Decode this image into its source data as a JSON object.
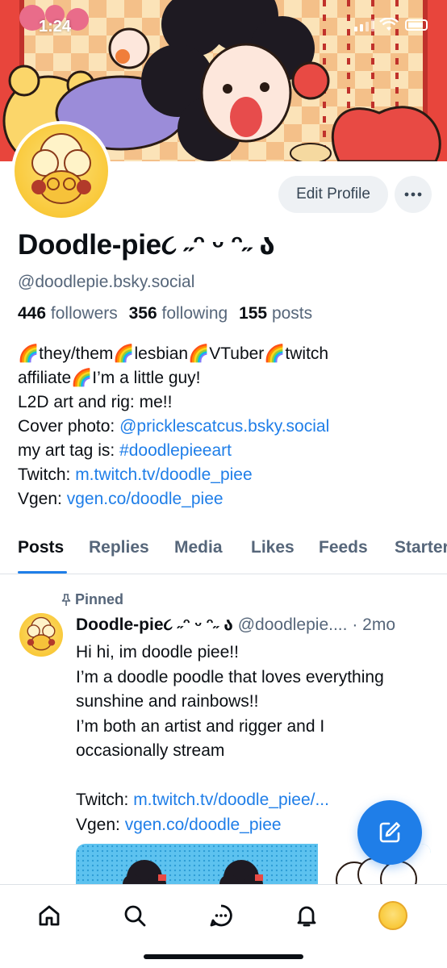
{
  "status_bar": {
    "time": "1:24"
  },
  "profile": {
    "display_name": "Doodle-pie૮ ˶ᵔ ᵕ ᵔ˶ ა",
    "handle": "@doodlepie.bsky.social",
    "stats": {
      "followers_count": "446",
      "followers_label": "followers",
      "following_count": "356",
      "following_label": "following",
      "posts_count": "155",
      "posts_label": "posts"
    },
    "edit_label": "Edit Profile",
    "bio": {
      "line1": "🌈they/them🌈lesbian🌈VTuber🌈twitch",
      "line2": "affiliate🌈I’m a little guy!",
      "line3": "L2D art and rig: me!!",
      "line4_prefix": "Cover photo: ",
      "line4_link": "@pricklescatcus.bsky.social",
      "line5_prefix": "my art tag is: ",
      "line5_link": "#doodlepieeart",
      "line6_prefix": "Twitch: ",
      "line6_link": "m.twitch.tv/doodle_piee",
      "line7_prefix": "Vgen: ",
      "line7_link": "vgen.co/doodle_piee"
    }
  },
  "tabs": [
    "Posts",
    "Replies",
    "Media",
    "Likes",
    "Feeds",
    "Starter Packs"
  ],
  "active_tab": "Posts",
  "post": {
    "pinned_label": "Pinned",
    "author_name": "Doodle-pie૮ ˶ᵔ ᵕ ᵔ˶ ა",
    "author_handle": "@doodlepie....",
    "time": "2mo",
    "lines": [
      "Hi hi, im doodle piee!!",
      "I’m a doodle poodle that loves everything",
      "sunshine and rainbows!!",
      "I’m both an artist and rigger and I",
      "occasionally stream"
    ],
    "twitch_prefix": "Twitch: ",
    "twitch_link": "m.twitch.tv/doodle_piee/...",
    "vgen_prefix": "Vgen: ",
    "vgen_link": "vgen.co/doodle_piee"
  },
  "icons": {
    "nav": [
      "home-icon",
      "search-icon",
      "chat-icon",
      "bell-icon",
      "profile-avatar"
    ],
    "fab": "compose-icon",
    "more": "ellipsis-icon",
    "pin": "pin-icon"
  },
  "colors": {
    "accent": "#1f7ee8",
    "muted": "#56667a",
    "text": "#0b0f14",
    "button_bg": "#eef1f4"
  }
}
